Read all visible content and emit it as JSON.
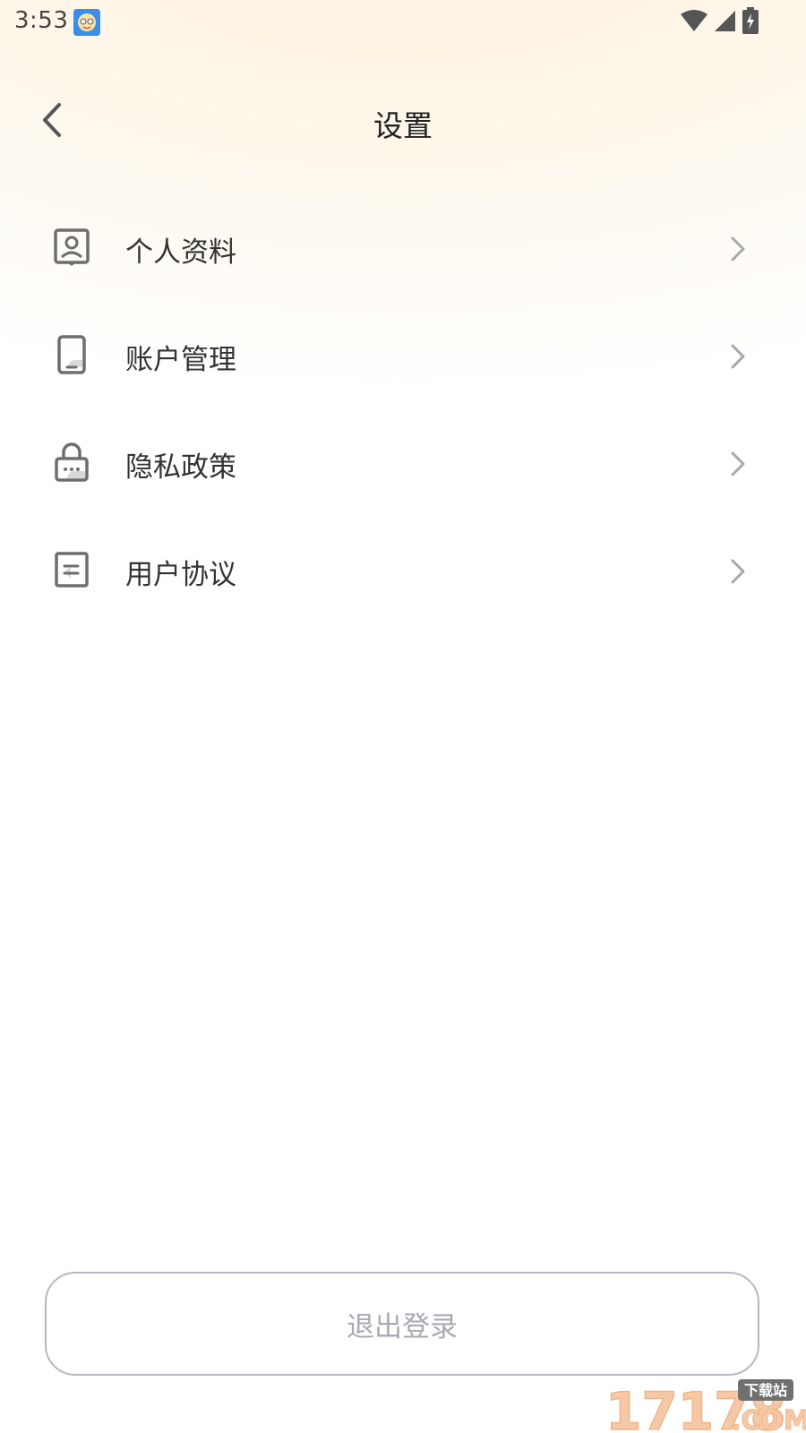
{
  "status_bar": {
    "time": "3:53",
    "icons": [
      "app-notification-icon",
      "wifi-icon",
      "cell-signal-icon",
      "battery-charging-icon"
    ]
  },
  "header": {
    "title": "设置",
    "back_icon": "chevron-left-icon"
  },
  "settings": {
    "items": [
      {
        "label": "个人资料",
        "icon": "profile-card-icon"
      },
      {
        "label": "账户管理",
        "icon": "phone-icon"
      },
      {
        "label": "隐私政策",
        "icon": "lock-icon"
      },
      {
        "label": "用户协议",
        "icon": "document-icon"
      }
    ],
    "chevron_icon": "chevron-right-icon"
  },
  "logout": {
    "label": "退出登录"
  },
  "watermark": {
    "number": "17178",
    "tag": "下载站",
    "suffix": ".COM"
  },
  "colors": {
    "background_tint": "#fdf0dc",
    "text_primary": "#333333",
    "icon_gray": "#6e6e6e",
    "chevron_gray": "#a7a7ad",
    "logout_text": "#a9a9b3",
    "logout_border": "#b7b7c0"
  }
}
